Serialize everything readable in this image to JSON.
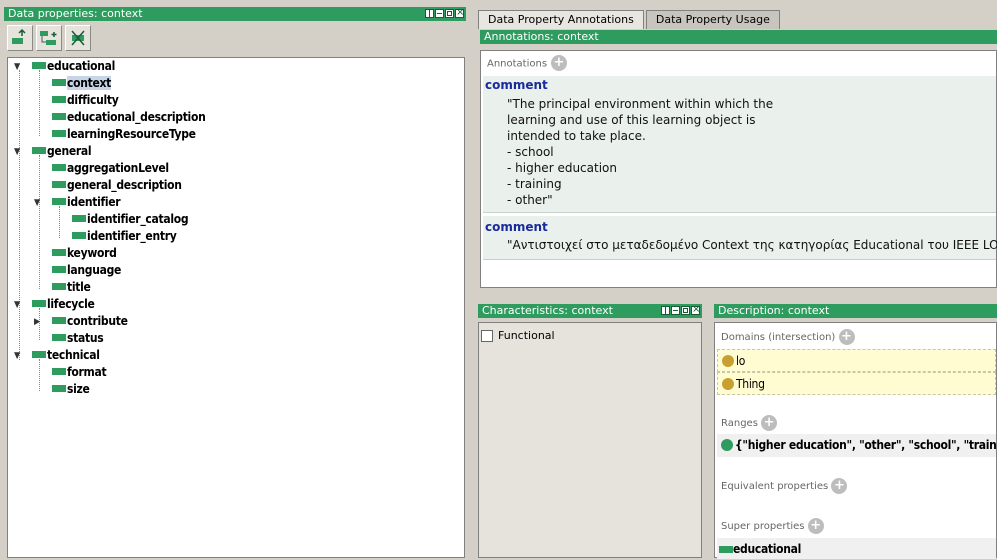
{
  "left_panel": {
    "title": "Data properties: context",
    "toolbar": [
      "add-subproperty-icon",
      "add-sibling-property-icon",
      "delete-property-icon"
    ],
    "tree": [
      {
        "label": "educational",
        "depth": 0,
        "expanded": true
      },
      {
        "label": "context",
        "depth": 1,
        "selected": true
      },
      {
        "label": "difficulty",
        "depth": 1
      },
      {
        "label": "educational_description",
        "depth": 1
      },
      {
        "label": "learningResourceType",
        "depth": 1
      },
      {
        "label": "general",
        "depth": 0,
        "expanded": true
      },
      {
        "label": "aggregationLevel",
        "depth": 1
      },
      {
        "label": "general_description",
        "depth": 1
      },
      {
        "label": "identifier",
        "depth": 1,
        "expanded": true
      },
      {
        "label": "identifier_catalog",
        "depth": 2
      },
      {
        "label": "identifier_entry",
        "depth": 2
      },
      {
        "label": "keyword",
        "depth": 1
      },
      {
        "label": "language",
        "depth": 1
      },
      {
        "label": "title",
        "depth": 1
      },
      {
        "label": "lifecycle",
        "depth": 0,
        "expanded": true
      },
      {
        "label": "contribute",
        "depth": 1,
        "collapsed": true
      },
      {
        "label": "status",
        "depth": 1
      },
      {
        "label": "technical",
        "depth": 0,
        "expanded": true
      },
      {
        "label": "format",
        "depth": 1
      },
      {
        "label": "size",
        "depth": 1
      }
    ]
  },
  "tabs": [
    {
      "label": "Data Property Annotations",
      "active": true
    },
    {
      "label": "Data Property Usage",
      "active": false
    }
  ],
  "annotations": {
    "title": "Annotations: context",
    "section_label": "Annotations",
    "comments": [
      {
        "key": "comment",
        "text": "\"The principal environment within which the\nlearning and use of this learning object is\nintended to take place.\n- school\n- higher education\n- training\n- other\""
      },
      {
        "key": "comment",
        "text": "\"Αντιστοιχεί στο μεταδεδομένο Context της κατηγορίας Educational του IEEE LOM\""
      }
    ]
  },
  "characteristics": {
    "title": "Characteristics: context",
    "functional_label": "Functional",
    "functional_checked": false
  },
  "description": {
    "title": "Description: context",
    "domains_label": "Domains (intersection)",
    "domains": [
      "lo",
      "Thing"
    ],
    "ranges_label": "Ranges",
    "ranges": [
      "{\"higher education\", \"other\", \"school\", \"training\"}"
    ],
    "equivalent_label": "Equivalent properties",
    "super_label": "Super properties",
    "super_properties": [
      "educational"
    ]
  },
  "colors": {
    "header_green": "#2e9c5e",
    "tree_swatch": "#2e9c5e",
    "domain_dot": "#c8a030",
    "comment_key": "#1a2a9a"
  }
}
